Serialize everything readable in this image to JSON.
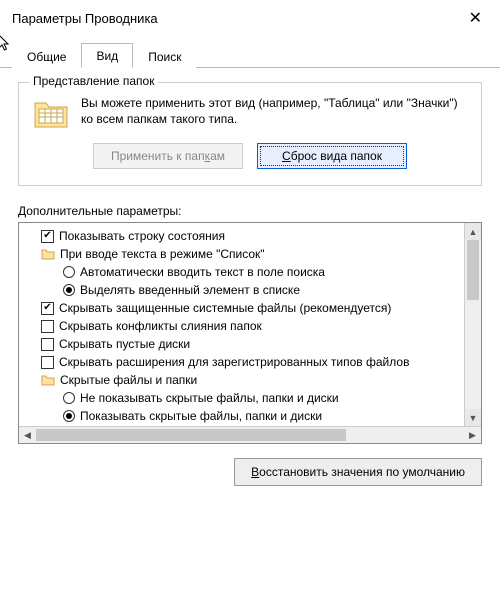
{
  "window": {
    "title": "Параметры Проводника"
  },
  "tabs": {
    "general": "Общие",
    "view": "Вид",
    "search": "Поиск"
  },
  "group": {
    "title": "Представление папок",
    "text": "Вы можете применить этот вид (например, \"Таблица\" или \"Значки\") ко всем папкам такого типа.",
    "apply_prefix": "Применить к пап",
    "apply_u": "к",
    "apply_suffix": "ам",
    "reset_u": "С",
    "reset_suffix": "брос вида папок"
  },
  "adv": {
    "label": "Дополнительные параметры:",
    "items": [
      {
        "type": "check",
        "checked": true,
        "indent": 20,
        "label": "Показывать строку состояния"
      },
      {
        "type": "folder",
        "checked": null,
        "indent": 20,
        "label": "При вводе текста в режиме \"Список\""
      },
      {
        "type": "radio",
        "checked": false,
        "indent": 42,
        "label": "Автоматически вводить текст в поле поиска"
      },
      {
        "type": "radio",
        "checked": true,
        "indent": 42,
        "label": "Выделять введенный элемент в списке"
      },
      {
        "type": "check",
        "checked": true,
        "indent": 20,
        "label": "Скрывать защищенные системные файлы (рекомендуется)"
      },
      {
        "type": "check",
        "checked": false,
        "indent": 20,
        "label": "Скрывать конфликты слияния папок"
      },
      {
        "type": "check",
        "checked": false,
        "indent": 20,
        "label": "Скрывать пустые диски"
      },
      {
        "type": "check",
        "checked": false,
        "indent": 20,
        "label": "Скрывать расширения для зарегистрированных типов файлов"
      },
      {
        "type": "folder",
        "checked": null,
        "indent": 20,
        "label": "Скрытые файлы и папки"
      },
      {
        "type": "radio",
        "checked": false,
        "indent": 42,
        "label": "Не показывать скрытые файлы, папки и диски"
      },
      {
        "type": "radio",
        "checked": true,
        "indent": 42,
        "label": "Показывать скрытые файлы, папки и диски"
      }
    ]
  },
  "restore": {
    "u": "В",
    "suffix": "осстановить значения по умолчанию"
  }
}
